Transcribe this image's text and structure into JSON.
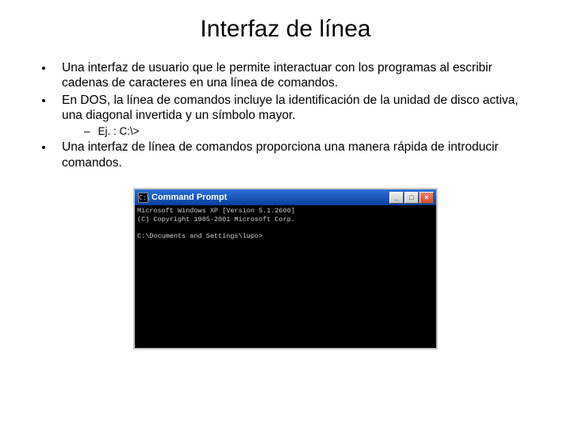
{
  "title": "Interfaz de línea",
  "bullets": {
    "b1": "Una interfaz de usuario que le permite interactuar con los programas al escribir cadenas de caracteres en una línea de comandos.",
    "b2": "En DOS, la línea de comandos incluye la identificación de la unidad de disco activa, una diagonal invertida y un símbolo mayor.",
    "b2_sub": "Ej. :  C:\\>",
    "b3": "Una interfaz de línea de comandos proporciona una manera rápida de introducir comandos."
  },
  "cmd": {
    "window_title": "Command Prompt",
    "icon_glyph": "C:\\",
    "btn_min": "_",
    "btn_max": "□",
    "btn_close": "×",
    "line1": "Microsoft Windows XP [Version 5.1.2600]",
    "line2": "(C) Copyright 1985-2001 Microsoft Corp.",
    "line3": "",
    "line4": "C:\\Documents and Settings\\lupo>"
  }
}
